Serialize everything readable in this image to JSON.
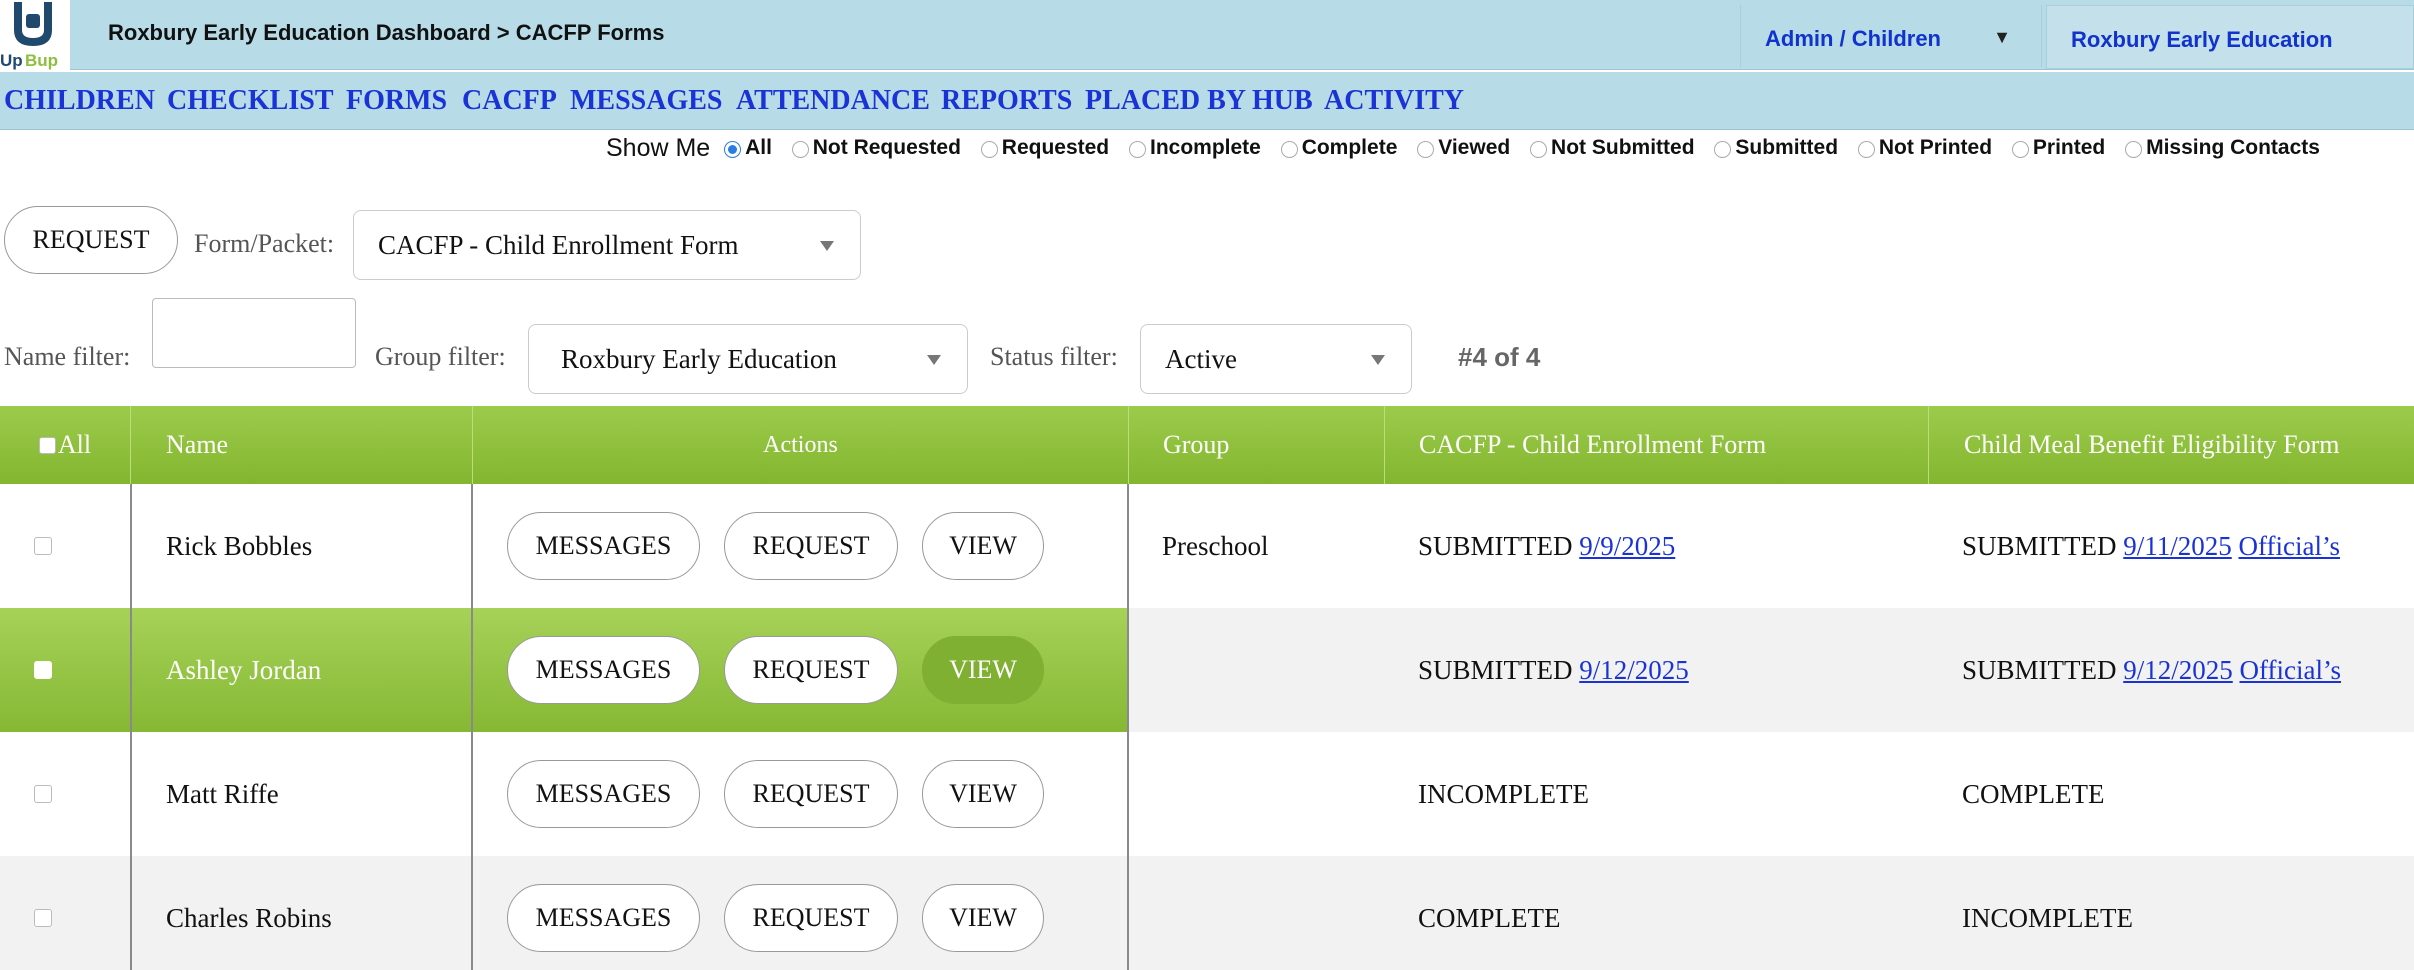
{
  "header": {
    "logo_text": "UpBup",
    "breadcrumb": "Roxbury Early Education Dashboard > CACFP Forms",
    "role_select": "Admin / Children",
    "organization": "Roxbury Early Education"
  },
  "nav": [
    "CHILDREN",
    "CHECKLIST",
    "FORMS",
    "CACFP",
    "MESSAGES",
    "ATTENDANCE",
    "REPORTS",
    "PLACED BY HUB",
    "ACTIVITY"
  ],
  "show_me": {
    "label": "Show Me",
    "options": [
      "All",
      "Not Requested",
      "Requested",
      "Incomplete",
      "Complete",
      "Viewed",
      "Not Submitted",
      "Submitted",
      "Not Printed",
      "Printed",
      "Missing Contacts"
    ],
    "selected": "All"
  },
  "request": {
    "button": "REQUEST",
    "form_label": "Form/Packet:",
    "form_value": "CACFP - Child Enrollment Form"
  },
  "filters": {
    "name_label": "Name filter:",
    "name_value": "",
    "group_label": "Group filter:",
    "group_value": "Roxbury Early Education",
    "status_label": "Status filter:",
    "status_value": "Active",
    "count": "#4 of 4"
  },
  "table": {
    "headers": [
      "All",
      "Name",
      "Actions",
      "Group",
      "CACFP - Child Enrollment Form",
      "Child Meal Benefit Eligibility Form"
    ],
    "action_labels": [
      "MESSAGES",
      "REQUEST",
      "VIEW"
    ],
    "rows": [
      {
        "name": "Rick Bobbles",
        "group": "Preschool",
        "cacfp_status": "SUBMITTED",
        "cacfp_date": "9/9/2025",
        "meal_status": "SUBMITTED",
        "meal_date": "9/11/2025",
        "meal_link": "Official’s"
      },
      {
        "name": "Ashley Jordan",
        "group": "",
        "cacfp_status": "SUBMITTED",
        "cacfp_date": "9/12/2025",
        "meal_status": "SUBMITTED",
        "meal_date": "9/12/2025",
        "meal_link": "Official’s"
      },
      {
        "name": "Matt Riffe",
        "group": "",
        "cacfp_status": "INCOMPLETE",
        "cacfp_date": "",
        "meal_status": "COMPLETE",
        "meal_date": "",
        "meal_link": ""
      },
      {
        "name": "Charles Robins",
        "group": "",
        "cacfp_status": "COMPLETE",
        "cacfp_date": "",
        "meal_status": "INCOMPLETE",
        "meal_date": "",
        "meal_link": ""
      }
    ]
  },
  "colors": {
    "header_bg": "#b7dbe7",
    "link_blue": "#1a33d6",
    "table_green": "#8dbf3c"
  }
}
